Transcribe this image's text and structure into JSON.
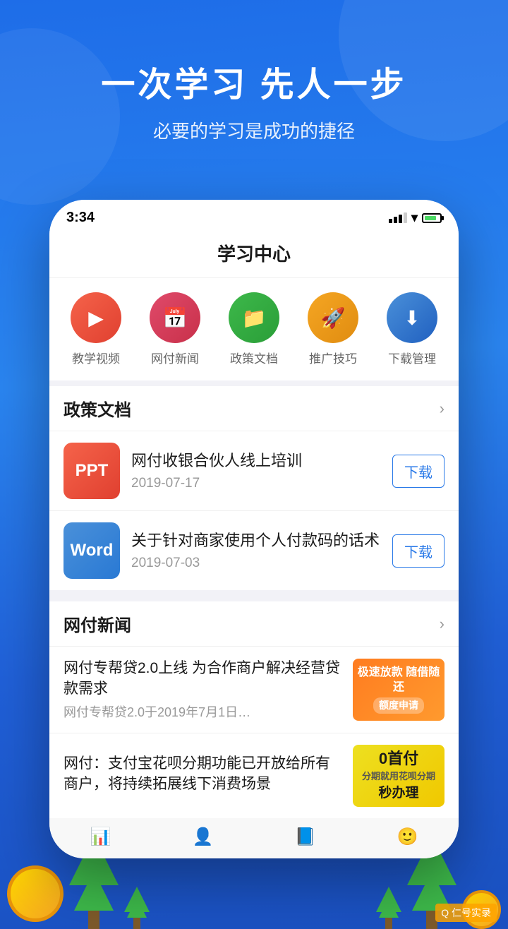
{
  "hero": {
    "title": "一次学习 先人一步",
    "subtitle": "必要的学习是成功的捷径"
  },
  "status_bar": {
    "time": "3:34"
  },
  "app": {
    "header": "学习中心"
  },
  "icons": [
    {
      "id": "teach-video",
      "label": "教学视频",
      "color": "#f5634a",
      "emoji": "▶"
    },
    {
      "id": "news",
      "label": "网付新闻",
      "color": "#e04a6a",
      "emoji": "📅"
    },
    {
      "id": "policy",
      "label": "政策文档",
      "color": "#3db84a",
      "emoji": "📁"
    },
    {
      "id": "tips",
      "label": "推广技巧",
      "color": "#f5a623",
      "emoji": "🚀"
    },
    {
      "id": "download",
      "label": "下载管理",
      "color": "#2979e8",
      "emoji": "⬇"
    }
  ],
  "policy_section": {
    "title": "政策文档",
    "arrow": "›",
    "items": [
      {
        "type": "PPT",
        "title": "网付收银合伙人线上培训",
        "date": "2019-07-17",
        "download_label": "下载"
      },
      {
        "type": "Word",
        "title": "关于针对商家使用个人付款码的话术",
        "date": "2019-07-03",
        "download_label": "下载"
      }
    ]
  },
  "news_section": {
    "title": "网付新闻",
    "arrow": "›",
    "items": [
      {
        "title": "网付专帮贷2.0上线 为合作商户解决经营贷款需求",
        "desc": "网付专帮贷2.0于2019年7月1日…",
        "thumb_type": "orange",
        "thumb_line1": "极速放款 随借随还",
        "thumb_line2": "额度申请"
      },
      {
        "title": "网付：支付宝花呗分期功能已开放给所有商户，将持续拓展线下消费场景",
        "desc": "",
        "thumb_type": "yellow",
        "thumb_line1": "0首付",
        "thumb_line2": "秒办理"
      }
    ]
  },
  "bottom_tabs": [
    {
      "id": "home",
      "icon": "📊",
      "label": ""
    },
    {
      "id": "user",
      "icon": "👤",
      "label": ""
    },
    {
      "id": "book",
      "icon": "📘",
      "label": ""
    },
    {
      "id": "person",
      "icon": "🙂",
      "label": ""
    }
  ],
  "watermark": {
    "text": "Q 仁号实录"
  }
}
